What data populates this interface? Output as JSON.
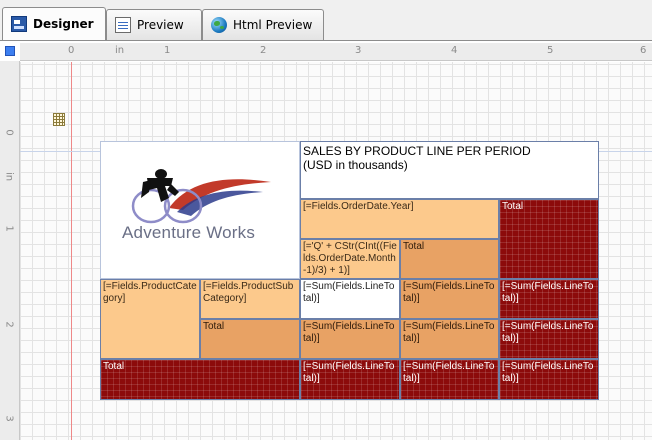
{
  "tabs": [
    {
      "label": "Designer",
      "icon": "designer-icon",
      "active": true
    },
    {
      "label": "Preview",
      "icon": "preview-icon",
      "active": false
    },
    {
      "label": "Html Preview",
      "icon": "globe-icon",
      "active": false
    }
  ],
  "ruler": {
    "horizontal": [
      "0",
      "in",
      "1",
      "2",
      "3",
      "4",
      "5",
      "6"
    ],
    "vertical": [
      "0",
      "in",
      "1",
      "2",
      "3"
    ]
  },
  "report": {
    "logo_text": "Adventure Works",
    "title_line1": "SALES BY PRODUCT LINE PER PERIOD",
    "title_line2": "(USD in thousands)",
    "year_field": "[=Fields.OrderDate.Year]",
    "total_top": "Total",
    "quarter_expr": "[='Q' + CStr(CInt((Fields.OrderDate.Month-1)/3) + 1)]",
    "total_quarter": "Total",
    "category_field": "[=Fields.ProductCategory]",
    "subcategory_field": "[=Fields.ProductSubCategory]",
    "sum_line_total": "[=Sum(Fields.LineTotal)]",
    "total_subcat": "Total",
    "total_grand": "Total"
  },
  "colors": {
    "peach": "#fcc98c",
    "tan": "#e8a264",
    "dark_red": "#8c0b0b"
  }
}
